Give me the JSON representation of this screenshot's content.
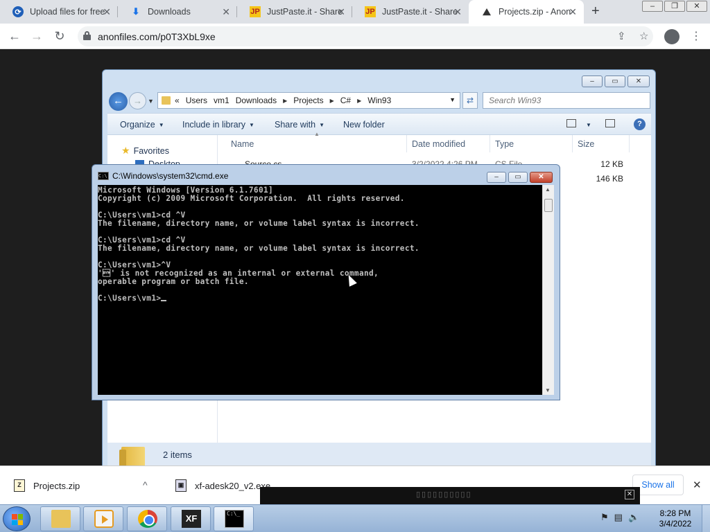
{
  "browser": {
    "tabs": [
      {
        "label": "Upload files for free",
        "icon": "upload-icon"
      },
      {
        "label": "Downloads",
        "icon": "download-icon"
      },
      {
        "label": "JustPaste.it - Share",
        "icon": "jp-icon"
      },
      {
        "label": "JustPaste.it - Share",
        "icon": "jp-icon"
      },
      {
        "label": "Projects.zip - Anon",
        "icon": "anonfiles-icon",
        "active": true
      }
    ],
    "url": "anonfiles.com/p0T3XbL9xe"
  },
  "explorer": {
    "breadcrumb": [
      "Users",
      "vm1",
      "Downloads",
      "Projects",
      "C#",
      "Win93"
    ],
    "search_placeholder": "Search Win93",
    "commands": {
      "organize": "Organize",
      "include": "Include in library",
      "share": "Share with",
      "newfolder": "New folder"
    },
    "nav": {
      "favorites": "Favorites",
      "desktop": "Desktop"
    },
    "columns": {
      "name": "Name",
      "date": "Date modified",
      "type": "Type",
      "size": "Size"
    },
    "files": [
      {
        "name": "Source.cs",
        "date": "3/2/2022 4:26 PM",
        "type": "CS File",
        "size": "12 KB"
      },
      {
        "name": "",
        "date": "",
        "type": "",
        "size": "146 KB"
      }
    ],
    "status": "2 items"
  },
  "cmd": {
    "title": "C:\\Windows\\system32\\cmd.exe",
    "lines": [
      "Microsoft Windows [Version 6.1.7601]",
      "Copyright (c) 2009 Microsoft Corporation.  All rights reserved.",
      "",
      "C:\\Users\\vm1>cd ^V",
      "The filename, directory name, or volume label syntax is incorrect.",
      "",
      "C:\\Users\\vm1>cd ^V",
      "The filename, directory name, or volume label syntax is incorrect.",
      "",
      "C:\\Users\\vm1>^V",
      "'\u0016' is not recognized as an internal or external command,",
      "operable program or batch file.",
      ""
    ],
    "prompt": "C:\\Users\\vm1>"
  },
  "downloads": {
    "items": [
      {
        "name": "Projects.zip"
      },
      {
        "name": "xf-adesk20_v2.exe"
      }
    ],
    "show_all": "Show all"
  },
  "taskbar": {
    "time": "8:28 PM",
    "date": "3/4/2022"
  }
}
